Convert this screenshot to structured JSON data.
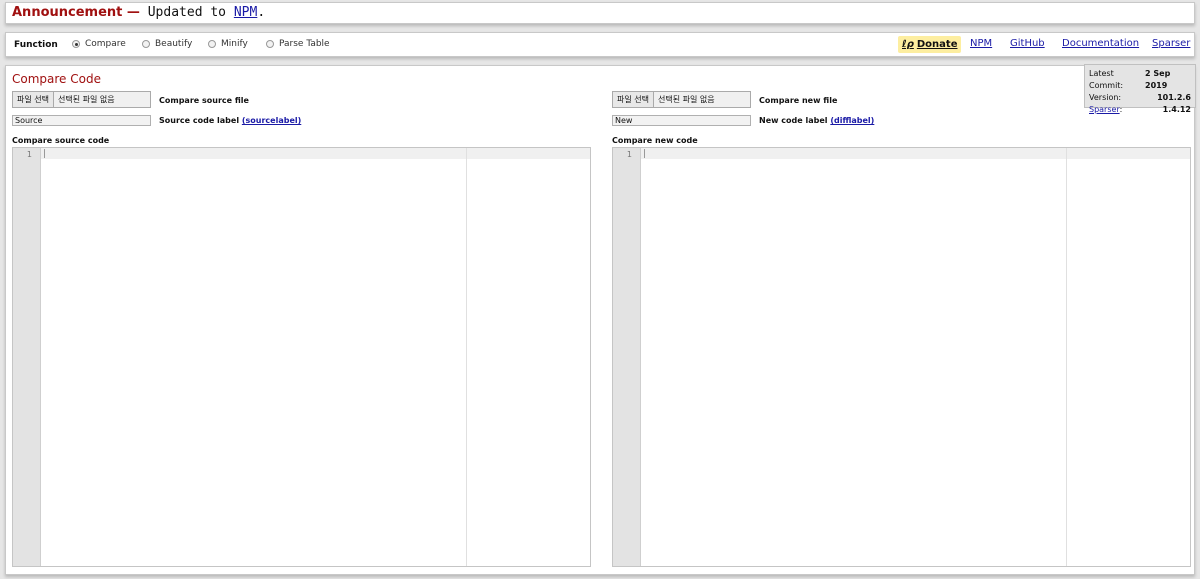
{
  "announcement": {
    "heading": "Announcement —",
    "text": "Updated to",
    "link": "NPM",
    "suffix": "."
  },
  "function_bar": {
    "label": "Function",
    "options": [
      {
        "label": "Compare",
        "selected": true
      },
      {
        "label": "Beautify",
        "selected": false
      },
      {
        "label": "Minify",
        "selected": false
      },
      {
        "label": "Parse Table",
        "selected": false
      }
    ],
    "donate_label": "Donate",
    "donate_icon": "ℓρ",
    "links": [
      "NPM",
      "GitHub",
      "Documentation",
      "Sparser"
    ]
  },
  "main": {
    "title": "Compare Code",
    "source": {
      "file_button": "파일 선택",
      "file_status": "선택된 파일 없음",
      "file_label": "Compare source file",
      "label_value": "Source",
      "label_text": "Source code label",
      "label_link": "(sourcelabel)",
      "code_heading": "Compare source code",
      "line_number": "1"
    },
    "new": {
      "file_button": "파일 선택",
      "file_status": "선택된 파일 없음",
      "file_label": "Compare new file",
      "label_value": "New",
      "label_text": "New code label",
      "label_link": "(difflabel)",
      "code_heading": "Compare new code",
      "line_number": "1"
    }
  },
  "commit_info": {
    "latest_label": "Latest Commit:",
    "latest_value": "2 Sep 2019",
    "version_label": "Version:",
    "version_value": "101.2.6",
    "sparser_label": "Sparser",
    "sparser_suffix": ":",
    "sparser_value": "1.4.12"
  }
}
